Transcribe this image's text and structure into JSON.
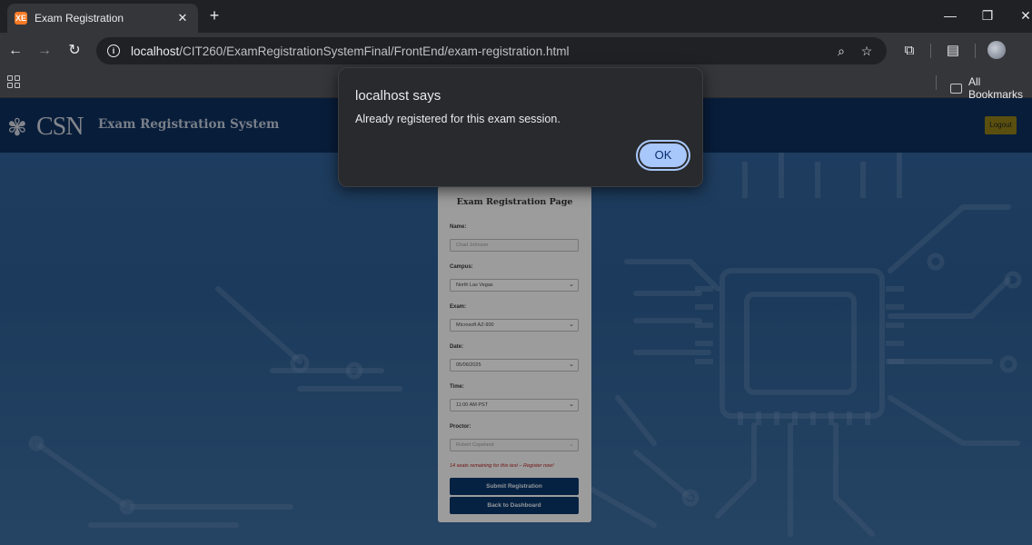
{
  "browser": {
    "tab_title": "Exam Registration",
    "tab_favicon_text": "XE",
    "url_host": "localhost",
    "url_path": "/CIT260/ExamRegistrationSystemFinal/FrontEnd/exam-registration.html",
    "bookmarks_label": "All Bookmarks"
  },
  "header": {
    "logo_text": "CSN",
    "system_title": "Exam Registration System",
    "logout_label": "Logout"
  },
  "form": {
    "title": "Exam Registration Page",
    "name_label": "Name:",
    "name_value": "Chad Johnson",
    "campus_label": "Campus:",
    "campus_value": "North Las Vegas",
    "exam_label": "Exam:",
    "exam_value": "Microsoft AZ-900",
    "date_label": "Date:",
    "date_value": "05/06/2025",
    "time_label": "Time:",
    "time_value": "11:00 AM PST",
    "proctor_label": "Proctor:",
    "proctor_value": "Robert Copeland",
    "seats_text": "14 seats remaining for this test – Register now!",
    "submit_label": "Submit Registration",
    "back_label": "Back to Dashboard"
  },
  "dialog": {
    "title": "localhost says",
    "message": "Already registered for this exam session.",
    "ok_label": "OK"
  },
  "icons": [
    "tab-favicon",
    "close-icon",
    "plus-icon",
    "minimize-icon",
    "restore-icon",
    "window-close-icon",
    "back-arrow-icon",
    "forward-arrow-icon",
    "reload-icon",
    "site-info-icon",
    "zoom-icon",
    "star-icon",
    "extensions-icon",
    "reading-mode-icon",
    "apps-grid-icon",
    "folder-icon",
    "csn-star-icon",
    "chevron-down-icon"
  ]
}
